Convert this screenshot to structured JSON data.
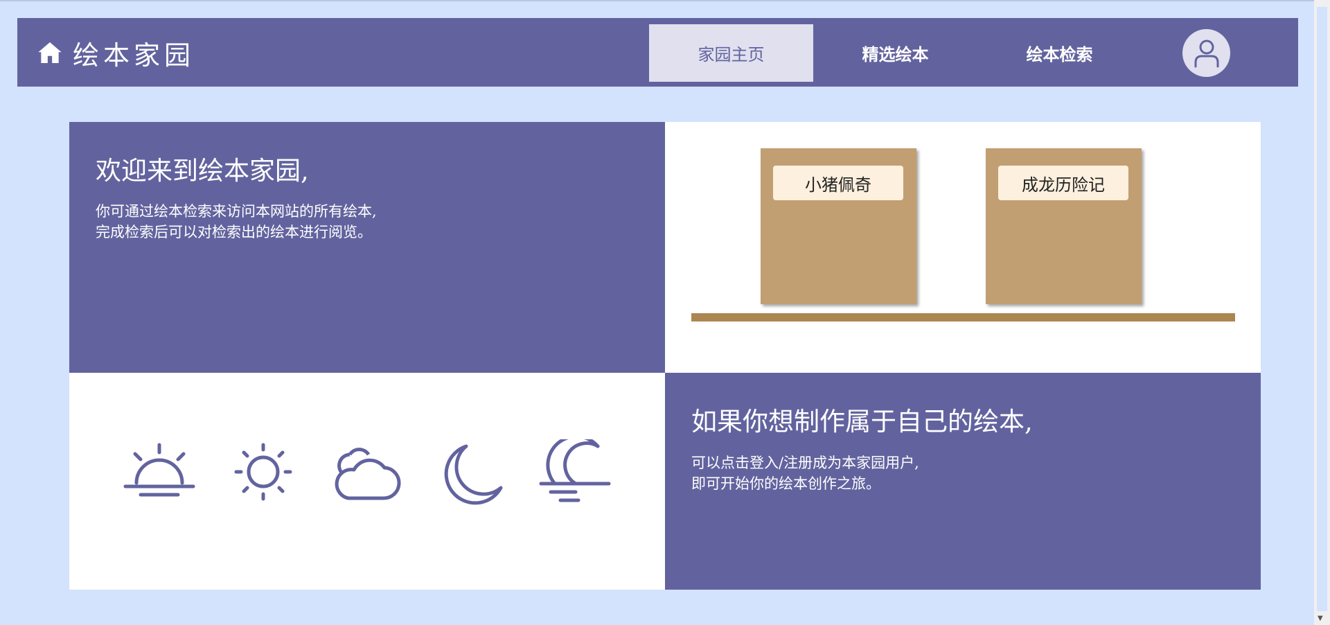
{
  "app": {
    "title": "绘本家园",
    "icon": "home-icon"
  },
  "nav": {
    "tabs": [
      {
        "label": "家园主页",
        "active": true
      },
      {
        "label": "精选绘本",
        "active": false
      },
      {
        "label": "绘本检索",
        "active": false
      }
    ],
    "avatar_icon": "user-icon"
  },
  "welcome": {
    "heading": "欢迎来到绘本家园,",
    "line1": "你可通过绘本检索来访问本网站的所有绘本,",
    "line2": "完成检索后可以对检索出的绘本进行阅览。"
  },
  "shelf": {
    "books": [
      {
        "title": "小猪佩奇"
      },
      {
        "title": "成龙历险记"
      }
    ]
  },
  "weather_icons": [
    "sunrise-icon",
    "sun-icon",
    "cloud-icon",
    "moon-icon",
    "moonset-icon"
  ],
  "create": {
    "heading": "如果你想制作属于自己的绘本,",
    "line1": "可以点击登入/注册成为本家园用户,",
    "line2": "即可开始你的绘本创作之旅。"
  },
  "colors": {
    "primary": "#62639e",
    "background": "#d3e2fd",
    "book": "#c19f72",
    "book_label": "#fdf0de",
    "shelf": "#ac8651",
    "active_tab": "#e0e0ef"
  }
}
